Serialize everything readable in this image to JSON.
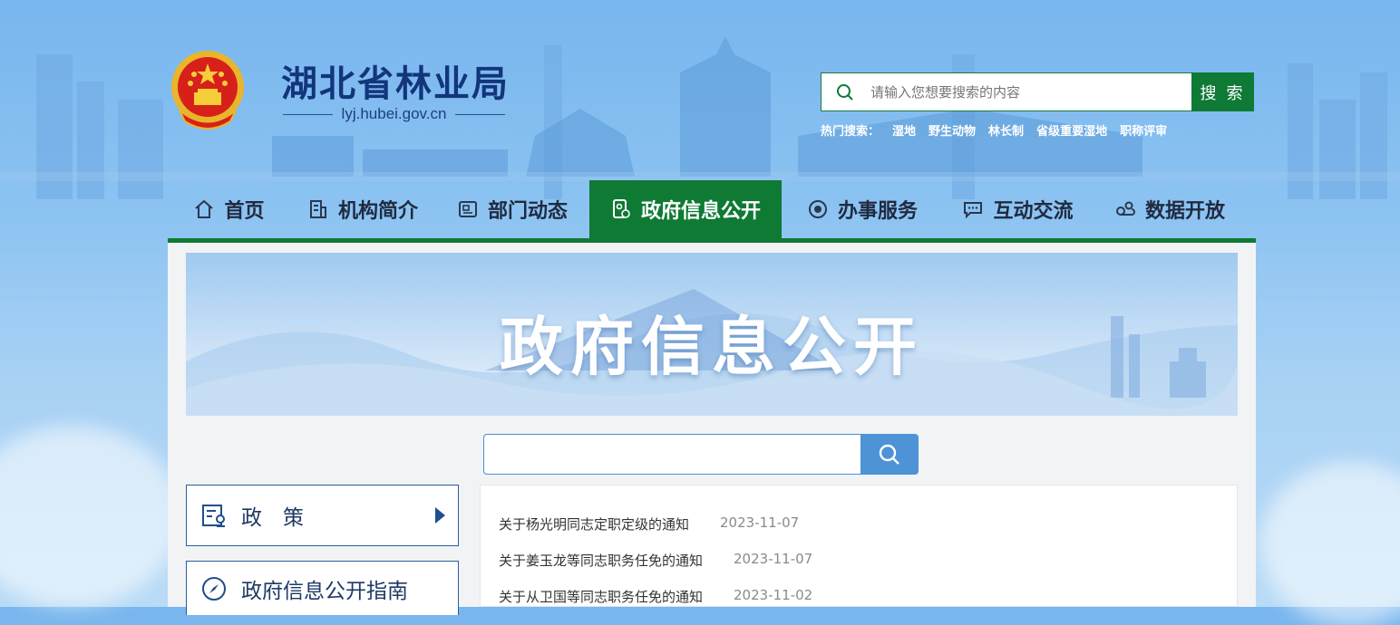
{
  "site": {
    "title": "湖北省林业局",
    "domain": "lyj.hubei.gov.cn"
  },
  "top_search": {
    "placeholder": "请输入您想要搜索的内容",
    "button_label": "搜 索",
    "hot_label": "热门搜索：",
    "hot_items": [
      "湿地",
      "野生动物",
      "林长制",
      "省级重要湿地",
      "职称评审"
    ]
  },
  "nav": {
    "items": [
      {
        "label": "首页",
        "icon": "home-icon"
      },
      {
        "label": "机构简介",
        "icon": "building-icon"
      },
      {
        "label": "部门动态",
        "icon": "news-icon"
      },
      {
        "label": "政府信息公开",
        "icon": "document-icon",
        "active": true
      },
      {
        "label": "办事服务",
        "icon": "service-icon"
      },
      {
        "label": "互动交流",
        "icon": "chat-icon"
      },
      {
        "label": "数据开放",
        "icon": "data-icon"
      }
    ]
  },
  "banner": {
    "title": "政府信息公开"
  },
  "side": {
    "items": [
      {
        "label": "政　策",
        "icon": "policy-icon"
      },
      {
        "label": "政府信息公开指南",
        "icon": "compass-icon"
      }
    ]
  },
  "news": {
    "items": [
      {
        "title": "关于杨光明同志定职定级的通知",
        "date": "2023-11-07"
      },
      {
        "title": "关于姜玉龙等同志职务任免的通知",
        "date": "2023-11-07"
      },
      {
        "title": "关于从卫国等同志职务任免的通知",
        "date": "2023-11-02"
      }
    ]
  },
  "colors": {
    "brand_green": "#0f7a34",
    "title_blue": "#13357c",
    "search_blue": "#4d93d6"
  }
}
